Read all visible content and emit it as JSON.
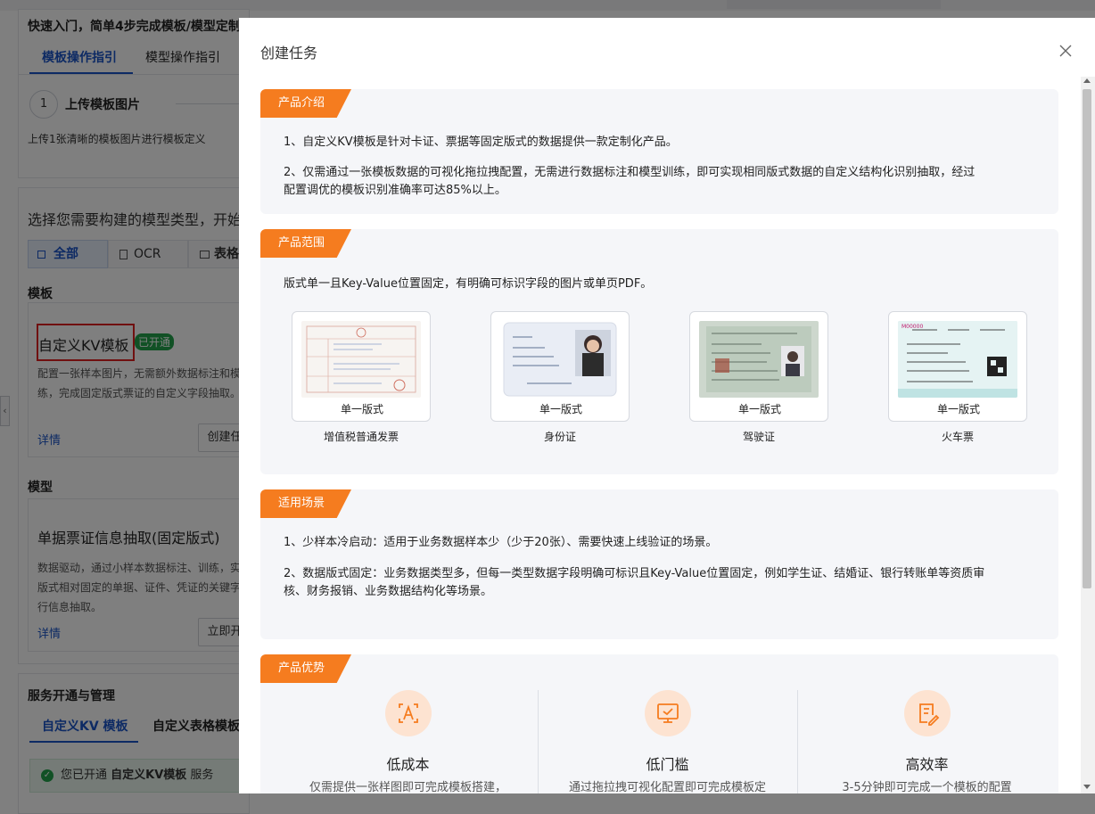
{
  "background": {
    "quick_start_title": "快速入门，简单4步完成模板/模型定制",
    "tabs": [
      "模板操作指引",
      "模型操作指引"
    ],
    "step": {
      "number": "1",
      "title": "上传模板图片",
      "desc": "上传1张清晰的模板图片进行模板定义"
    },
    "choose_type_text": "选择您需要构建的模型类型，开始",
    "filters": [
      "全部",
      "OCR",
      "表格"
    ],
    "template_section_title": "模板",
    "template_card": {
      "title": "自定义KV模板",
      "badge": "已开通",
      "desc_line1": "配置一张样本图片，无需额外数据标注和模",
      "desc_line2": "练，完成固定版式票证的自定义字段抽取。",
      "detail_link": "详情",
      "create_button": "创建任"
    },
    "model_section_title": "模型",
    "model_card": {
      "title": "单据票证信息抽取(固定版式)",
      "desc_line1": "数据驱动，通过小样本数据标注、训练，实",
      "desc_line2": "版式相对固定的单据、证件、凭证的关键字",
      "desc_line3": "行信息抽取。",
      "detail_link": "详情",
      "start_button": "立即开"
    },
    "service_section_title": "服务开通与管理",
    "service_tabs": [
      "自定义KV 模板",
      "自定义表格模板"
    ],
    "service_notice": {
      "prefix": "您已开通 ",
      "name": "自定义KV模板",
      "suffix": " 服务"
    }
  },
  "modal": {
    "title": "创建任务",
    "sections": {
      "intro": {
        "tag": "产品介绍",
        "p1": "1、自定义KV模板是针对卡证、票据等固定版式的数据提供一款定制化产品。",
        "p2_line1": "2、仅需通过一张模板数据的可视化拖拉拽配置，无需进行数据标注和模型训练，即可实现相同版式数据的自定义结构化识别抽取，经过",
        "p2_line2": "配置调优的模板识别准确率可达85%以上。"
      },
      "scope": {
        "tag": "产品范围",
        "desc": "版式单一且Key-Value位置固定，有明确可标识字段的图片或单页PDF。",
        "docs": [
          {
            "caption": "单一版式",
            "name": "增值税普通发票"
          },
          {
            "caption": "单一版式",
            "name": "身份证"
          },
          {
            "caption": "单一版式",
            "name": "驾驶证"
          },
          {
            "caption": "单一版式",
            "name": "火车票"
          }
        ]
      },
      "scenario": {
        "tag": "适用场景",
        "p1": "1、少样本冷启动：适用于业务数据样本少（少于20张）、需要快速上线验证的场景。",
        "p2_line1": "2、数据版式固定：业务数据类型多，但每一类型数据字段明确可标识且Key-Value位置固定，例如学生证、结婚证、银行转账单等资质审",
        "p2_line2": "核、财务报销、业务数据结构化等场景。"
      },
      "advantage": {
        "tag": "产品优势",
        "items": [
          {
            "icon": "text-scan-icon",
            "title": "低成本",
            "desc": "仅需提供一张样图即可完成模板搭建，"
          },
          {
            "icon": "monitor-icon",
            "title": "低门槛",
            "desc": "通过拖拉拽可视化配置即可完成模板定"
          },
          {
            "icon": "document-edit-icon",
            "title": "高效率",
            "desc": "3-5分钟即可完成一个模板的配置"
          }
        ]
      }
    }
  },
  "colors": {
    "accent_orange": "#f57c1f",
    "link_blue": "#1a55c8",
    "badge_green": "#22a34b"
  }
}
